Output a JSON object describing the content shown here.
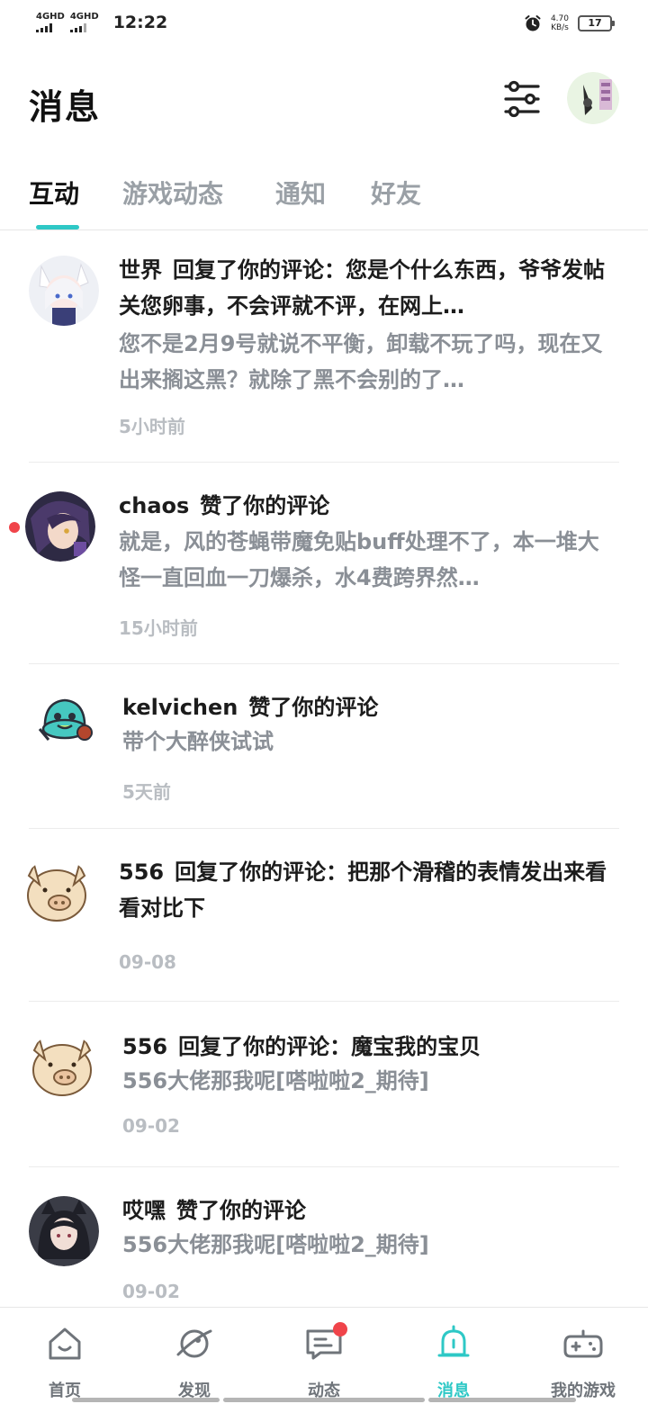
{
  "status_bar": {
    "network_1": "4GHD",
    "network_2": "4GHD",
    "time": "12:22",
    "speed_value": "4.70",
    "speed_unit": "KB/s",
    "battery": "17"
  },
  "header": {
    "title": "消息"
  },
  "tabs": [
    {
      "label": "互动",
      "active": true
    },
    {
      "label": "游戏动态",
      "active": false
    },
    {
      "label": "通知",
      "active": false
    },
    {
      "label": "好友",
      "active": false
    }
  ],
  "messages": [
    {
      "user": "世界",
      "action": "回复了你的评论：您是个什么东西，爷爷发帖关您卵事，不会评就不评，在网上…",
      "body": "您不是2月9号就说不平衡，卸载不玩了吗，现在又出来搁这黑？就除了黑不会别的了…",
      "time": "5小时前",
      "unread": false
    },
    {
      "user": "chaos",
      "action": "赞了你的评论",
      "body": "就是，风的苍蝇带魔免贴buff处理不了，本一堆大怪一直回血一刀爆杀，水4费跨界然…",
      "time": "15小时前",
      "unread": true
    },
    {
      "user": "kelvichen",
      "action": "赞了你的评论",
      "body": "带个大醉侠试试",
      "time": "5天前",
      "unread": false
    },
    {
      "user": "556",
      "action": "回复了你的评论：把那个滑稽的表情发出来看看对比下",
      "body": "",
      "time": "09-08",
      "unread": false
    },
    {
      "user": "556",
      "action": "回复了你的评论：魔宝我的宝贝",
      "body": "556大佬那我呢[嗒啦啦2_期待]",
      "time": "09-02",
      "unread": false
    },
    {
      "user": "哎嘿",
      "action": "赞了你的评论",
      "body": "556大佬那我呢[嗒啦啦2_期待]",
      "time": "09-02",
      "unread": false
    }
  ],
  "bottom_nav": [
    {
      "label": "首页",
      "icon": "home-icon",
      "active": false,
      "badge": false
    },
    {
      "label": "发现",
      "icon": "planet-icon",
      "active": false,
      "badge": false
    },
    {
      "label": "动态",
      "icon": "chat-icon",
      "active": false,
      "badge": true
    },
    {
      "label": "消息",
      "icon": "bell-icon",
      "active": true,
      "badge": false
    },
    {
      "label": "我的游戏",
      "icon": "gamepad-icon",
      "active": false,
      "badge": false
    }
  ],
  "colors": {
    "accent": "#2ec8c6",
    "badge": "#f0444a",
    "secondary_text": "#8a8f96",
    "time_text": "#b9bdc2"
  }
}
